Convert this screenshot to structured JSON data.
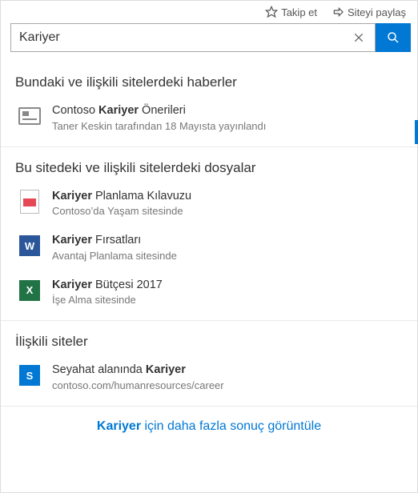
{
  "topbar": {
    "follow_label": "Takip et",
    "share_label": "Siteyi paylaş"
  },
  "search": {
    "query": "Kariyer"
  },
  "sections": {
    "news": {
      "header": "Bundaki ve ilişkili sitelerdeki haberler",
      "item1": {
        "title_bold": "Kariyer",
        "title_prefix": "Contoso ",
        "title_suffix": " Önerileri",
        "sub": "Taner Keskin tarafından 18 Mayısta yayınlandı"
      }
    },
    "files": {
      "header": "Bu sitedeki ve ilişkili sitelerdeki dosyalar",
      "item1": {
        "title_bold": "Kariyer",
        "title_suffix": " Planlama Kılavuzu",
        "sub": "Contoso’da Yaşam sitesinde"
      },
      "item2": {
        "title_bold": "Kariyer",
        "title_suffix": " Fırsatları",
        "sub": "Avantaj Planlama sitesinde"
      },
      "item3": {
        "title_bold": "Kariyer",
        "title_suffix": " Bütçesi 2017",
        "sub": "İşe Alma sitesinde"
      }
    },
    "sites": {
      "header": "İlişkili siteler",
      "item1": {
        "title_prefix": "Seyahat alanında ",
        "title_bold": "Kariyer",
        "sub": "contoso.com/humanresources/career"
      }
    }
  },
  "more": {
    "bold": "Kariyer",
    "rest": " için daha fazla sonuç görüntüle"
  },
  "icon_letters": {
    "word": "W",
    "excel": "X",
    "sp": "S"
  }
}
